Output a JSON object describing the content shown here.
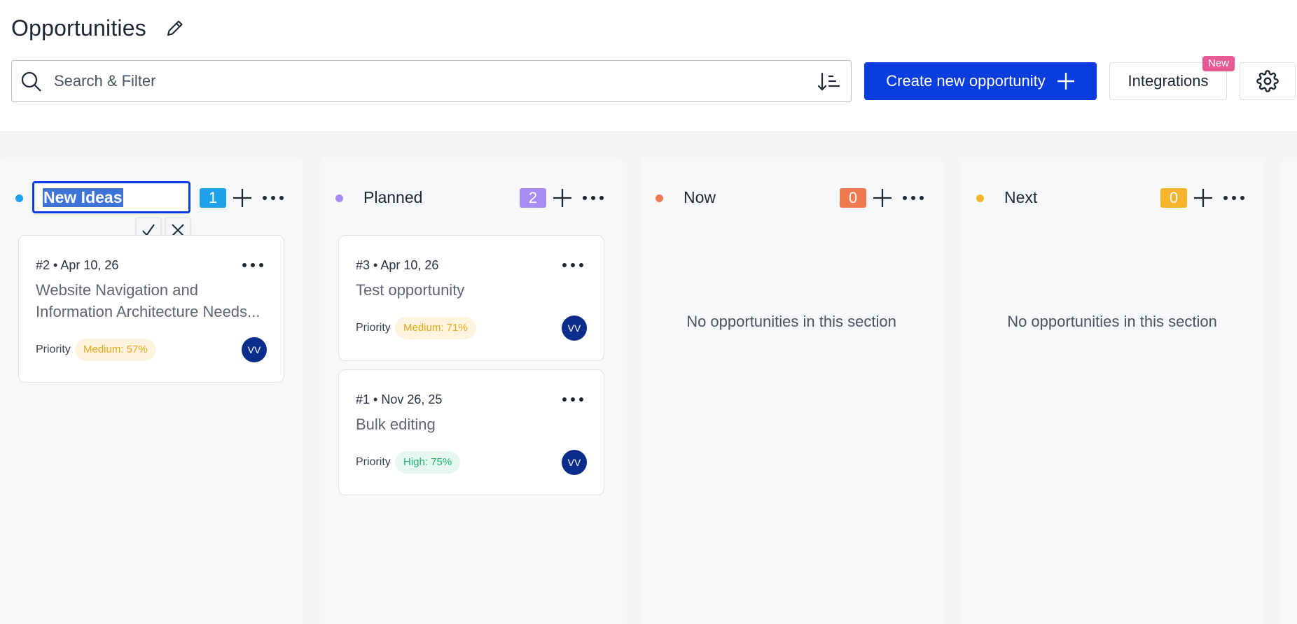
{
  "header": {
    "title": "Opportunities",
    "search_placeholder": "Search & Filter",
    "create_label": "Create new opportunity",
    "integrations_label": "Integrations",
    "new_badge": "New"
  },
  "colors": {
    "primary": "#0a3de0",
    "new_ideas": "#1da1e8",
    "planned": "#a98bf5",
    "now": "#ef7a4f",
    "next": "#f6b42a",
    "avatar": "#0c2d8c"
  },
  "columns": [
    {
      "title": "New Ideas",
      "count": "1",
      "editing": true,
      "cards": [
        {
          "id": "#2",
          "sep": "•",
          "date": "Apr 10, 26",
          "title": "Website Navigation and Information Architecture Needs...",
          "priority_label": "Priority",
          "priority": "Medium: 57%",
          "avatar": "VV"
        }
      ]
    },
    {
      "title": "Planned",
      "count": "2",
      "cards": [
        {
          "id": "#3",
          "sep": "•",
          "date": "Apr 10, 26",
          "title": "Test opportunity",
          "priority_label": "Priority",
          "priority": "Medium: 71%",
          "avatar": "VV"
        },
        {
          "id": "#1",
          "sep": "•",
          "date": "Nov 26, 25",
          "title": "Bulk editing",
          "priority_label": "Priority",
          "priority": "High: 75%",
          "avatar": "VV"
        }
      ]
    },
    {
      "title": "Now",
      "count": "0",
      "empty": "No opportunities in this section"
    },
    {
      "title": "Next",
      "count": "0",
      "empty": "No opportunities in this section"
    }
  ]
}
